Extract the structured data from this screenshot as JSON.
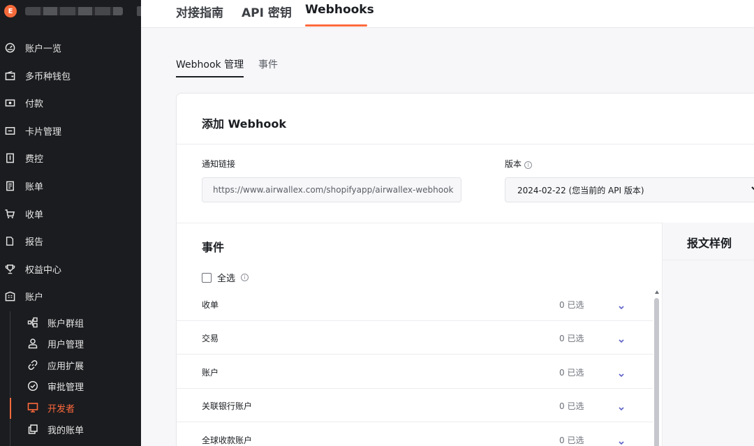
{
  "sidebar": {
    "brand_initial": "E",
    "items": [
      {
        "label": "账户一览",
        "icon": "dashboard-gauge-icon"
      },
      {
        "label": "多币种钱包",
        "icon": "wallet-icon"
      },
      {
        "label": "付款",
        "icon": "payment-icon"
      },
      {
        "label": "卡片管理",
        "icon": "card-icon"
      },
      {
        "label": "费控",
        "icon": "expense-icon"
      },
      {
        "label": "账单",
        "icon": "bill-icon"
      },
      {
        "label": "收单",
        "icon": "cart-icon"
      },
      {
        "label": "报告",
        "icon": "report-icon"
      },
      {
        "label": "权益中心",
        "icon": "trophy-icon"
      },
      {
        "label": "账户",
        "icon": "building-icon"
      }
    ],
    "sub_items": [
      {
        "label": "账户群组",
        "icon": "org-tree-icon"
      },
      {
        "label": "用户管理",
        "icon": "user-icon"
      },
      {
        "label": "应用扩展",
        "icon": "link-icon"
      },
      {
        "label": "审批管理",
        "icon": "check-circle-icon"
      },
      {
        "label": "开发者",
        "icon": "monitor-icon",
        "active": true
      },
      {
        "label": "我的账单",
        "icon": "copy-icon"
      }
    ]
  },
  "top_tabs": [
    {
      "label": "对接指南"
    },
    {
      "label": "API 密钥"
    },
    {
      "label": "Webhooks",
      "active": true
    }
  ],
  "sub_tabs": [
    {
      "label": "Webhook 管理",
      "active": true
    },
    {
      "label": "事件"
    }
  ],
  "card": {
    "title": "添加 Webhook",
    "url_label": "通知链接",
    "url_value": "https://www.airwallex.com/shopifyapp/airwallex-webhook",
    "version_label": "版本",
    "version_value": "2024-02-22 (您当前的 API 版本)",
    "events_title": "事件",
    "select_all_label": "全选",
    "sample_title": "报文样例",
    "events": [
      {
        "name": "收单",
        "count": "0 已选"
      },
      {
        "name": "交易",
        "count": "0 已选"
      },
      {
        "name": "账户",
        "count": "0 已选"
      },
      {
        "name": "关联银行账户",
        "count": "0 已选"
      },
      {
        "name": "全球收款账户",
        "count": "0 已选"
      }
    ]
  },
  "colors": {
    "accent": "#ff6a3d",
    "sidebar_bg": "#1b1c1f",
    "chevron": "#5b5fc7"
  }
}
